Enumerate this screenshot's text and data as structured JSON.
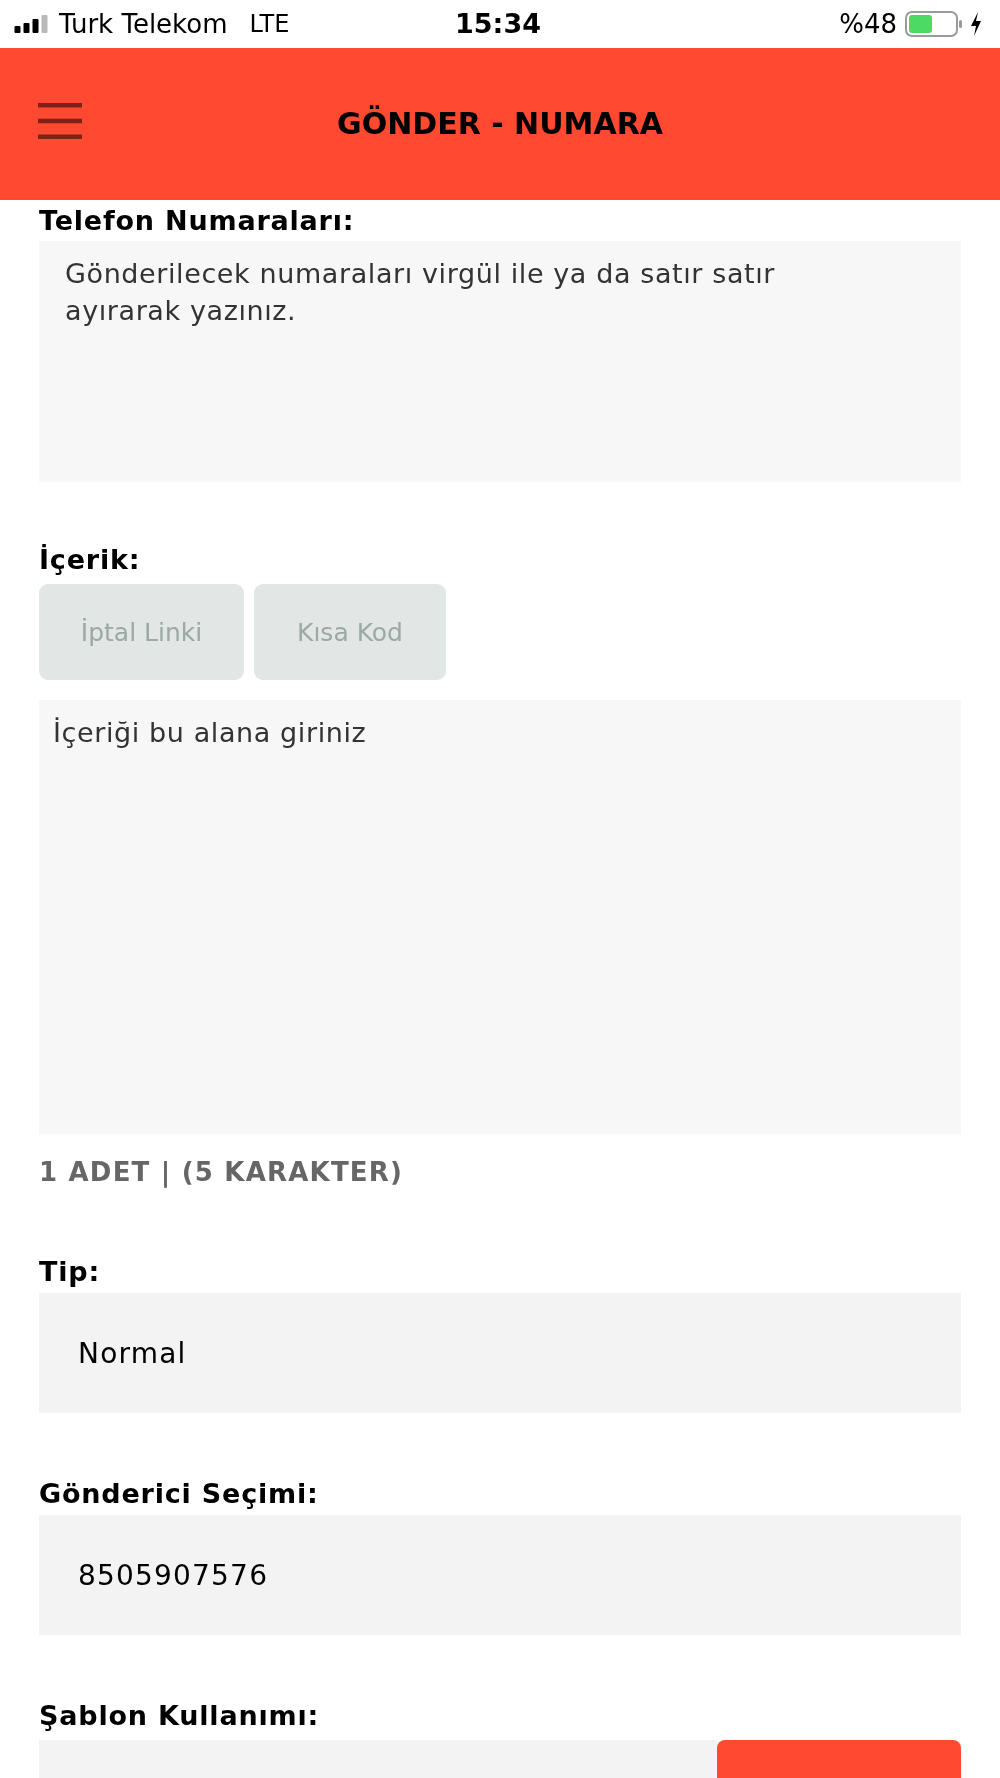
{
  "status_bar": {
    "carrier": "Turk Telekom",
    "network": "LTE",
    "time": "15:34",
    "battery": "%48"
  },
  "header": {
    "title": "GÖNDER - NUMARA"
  },
  "phone_numbers": {
    "label": "Telefon Numaraları:",
    "placeholder": "Gönderilecek numaraları virgül ile ya da satır satır ayırarak yazınız."
  },
  "content": {
    "label": "İçerik:",
    "buttons": [
      {
        "label": "İptal Linki",
        "disabled": true
      },
      {
        "label": "Kısa Kod",
        "disabled": true
      }
    ],
    "placeholder": "İçeriği bu alana giriniz",
    "counter": "1 ADET | (5 KARAKTER)"
  },
  "type": {
    "label": "Tip:",
    "value": "Normal"
  },
  "sender": {
    "label": "Gönderici Seçimi:",
    "value": "8505907576"
  },
  "template": {
    "label": "Şablon Kullanımı:"
  }
}
